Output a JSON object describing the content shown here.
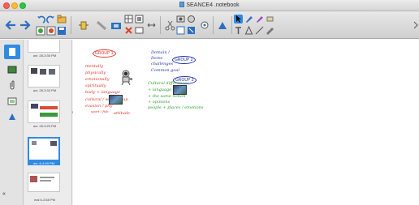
{
  "window": {
    "title": "SEANCE4 .notebook"
  },
  "toolbar": {
    "tools": [
      "back-icon",
      "forward-icon",
      "undo-icon",
      "redo-icon",
      "open-icon",
      "save-icon",
      "paste-icon",
      "screen-shade-icon",
      "document-camera-icon",
      "table-icon",
      "delete-icon",
      "full-screen-icon",
      "capture-icon",
      "display-icon",
      "select-icon",
      "pen-icon",
      "eraser-icon",
      "line-icon",
      "shape-icon",
      "magic-pen-icon",
      "fill-icon",
      "text-icon"
    ]
  },
  "sidebar": {
    "tabs": [
      "page-sorter",
      "gallery",
      "attachments",
      "properties",
      "add-ons"
    ]
  },
  "pages": {
    "thumbnails": [
      {
        "label": "avr. 28-3:35 PM"
      },
      {
        "label": "avr. 28-3:33 PM"
      },
      {
        "label": "avr. 28-3:25 PM"
      },
      {
        "label": "avr. 6-4:49 PM",
        "selected": true
      },
      {
        "label": "mai 6-3:58 PM"
      }
    ],
    "collapse_glyph": "«"
  },
  "canvas": {
    "group1": "GROUP 1",
    "group2": "GROUP 2",
    "group3": "GROUP 3",
    "red_notes": [
      "mentally",
      "physically",
      "emotionally",
      "spiritually",
      "body + language",
      "cultural / sexe group",
      "evasion / phy",
      "sport / fish",
      "attitude"
    ],
    "blue_notes": [
      "Domain /",
      "Items",
      "challenges",
      "Common goal"
    ],
    "green_notes": [
      "Cultural differences",
      "+ language",
      "+ the same notion",
      "+ opinions",
      "people + places / emotions"
    ]
  },
  "colors": {
    "accent": "#2f8be4",
    "red_ink": "#e0322b",
    "blue_ink": "#2233aa",
    "green_ink": "#2a9a2a"
  }
}
